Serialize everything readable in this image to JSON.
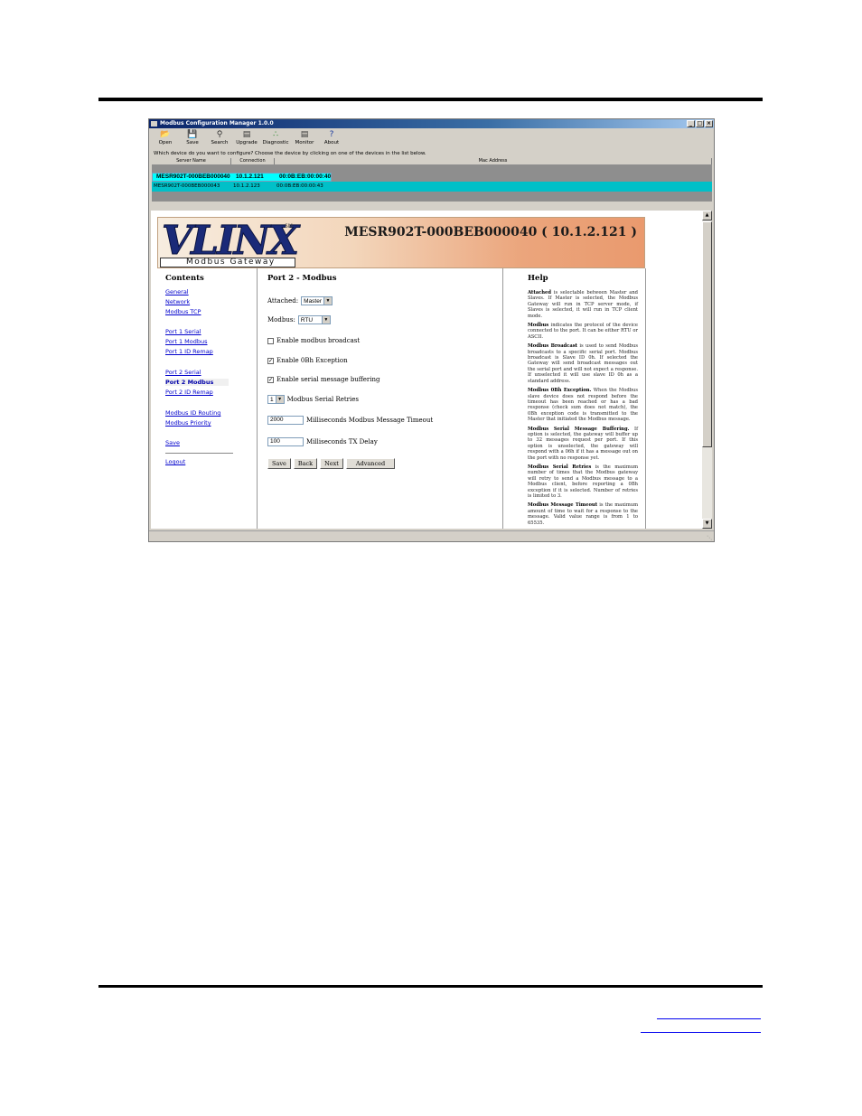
{
  "app": {
    "title": "Modbus Configuration Manager 1.0.0",
    "window_buttons": [
      "_",
      "□",
      "×"
    ],
    "toolbar": [
      {
        "icon": "open-folder-icon",
        "label": "Open"
      },
      {
        "icon": "save-disk-icon",
        "label": "Save"
      },
      {
        "icon": "search-icon",
        "label": "Search"
      },
      {
        "icon": "upgrade-icon",
        "label": "Upgrade"
      },
      {
        "icon": "diagnostic-icon",
        "label": "Diagnostic"
      },
      {
        "icon": "monitor-icon",
        "label": "Monitor"
      },
      {
        "icon": "help-icon",
        "label": "About"
      }
    ],
    "prompt": "Which device do you want to configure? Choose the device by clicking on one of the devices in the list below.",
    "devices": {
      "columns": [
        "Server Name",
        "Connection",
        "Mac Address"
      ],
      "rows": [
        {
          "name": "MESR902T-000BEB000040",
          "connection": "10.1.2.121",
          "mac": "00:0B:EB:00:00:40"
        },
        {
          "name": "MESR902T-000BEB000043",
          "connection": "10.1.2.123",
          "mac": "00:0B:EB:00:00:43"
        }
      ]
    }
  },
  "banner": {
    "logo": "VLINX",
    "logo_tm": "SM",
    "subtitle": "Modbus Gateway",
    "device_title": "MESR902T-000BEB000040 ( 10.1.2.121 )"
  },
  "nav": {
    "heading": "Contents",
    "items": [
      "General",
      "Network",
      "Modbus TCP",
      "Port 1 Serial",
      "Port 1 Modbus",
      "Port 1 ID Remap",
      "Port 2 Serial",
      "Port 2 Modbus",
      "Port 2 ID Remap",
      "Modbus ID Routing",
      "Modbus Priority",
      "Save",
      "Logout"
    ],
    "active": "Port 2 Modbus"
  },
  "form": {
    "heading": "Port 2 - Modbus",
    "attached_label": "Attached:",
    "attached_value": "Master",
    "modbus_label": "Modbus:",
    "modbus_value": "RTU",
    "broadcast_label": "Enable modbus broadcast",
    "broadcast_checked": false,
    "exception_label": "Enable 0Bh Exception",
    "exception_checked": true,
    "buffering_label": "Enable serial message buffering",
    "buffering_checked": true,
    "retries_value": "1",
    "retries_label": "Modbus Serial Retries",
    "timeout_value": "2000",
    "timeout_label": "Milliseconds Modbus Message Timeout",
    "txdelay_value": "100",
    "txdelay_label": "Milliseconds TX Delay",
    "buttons": [
      "Save",
      "Back",
      "Next",
      "Advanced"
    ]
  },
  "help": {
    "heading": "Help",
    "paragraphs": [
      {
        "term": "Attached",
        "text": " is selectable between Master and Slaves. If Master is selected, the Modbus Gateway will run in TCP server mode, if Slaves is selected, it will run in TCP client mode."
      },
      {
        "term": "Modbus",
        "text": " indicates the protocol of the device connected to the port. It can be either RTU or ASCII."
      },
      {
        "term": "Modbus Broadcast",
        "text": " is used to send Modbus broadcasts to a specific serial port. Modbus broadcast is Slave ID 0h. If selected the Gateway will send broadcast messages out the serial port and will not expect a response. If unselected it will use slave ID 0h as a standard address."
      },
      {
        "term": "Modbus 0Bh Exception.",
        "text": " When the Modbus slave device does not respond before the timeout has been reached or has a bad response (check sum does not match), the 0Bh exception code is transmitted to the Master that initiated the Modbus message."
      },
      {
        "term": "Modbus Serial Message Buffering.",
        "text": " If option is selected, the gateway will buffer up to 32 messages request per port. If this option is unselected, the gateway will respond with a 06h if it has a message out on the port with no response yet."
      },
      {
        "term": "Modbus Serial Retries",
        "text": " is the maximum number of times that the Modbus gateway will retry to send a Modbus message to a Modbus client, before reporting a 0Bh exception if it is selected. Number of retries is limited to 3."
      },
      {
        "term": "Modbus Message Timeout",
        "text": " is the maximum amount of time to wait for a response to the message. Valid value range is from 1 to 65535."
      }
    ]
  },
  "colors": {
    "selected_row": "#00ffff",
    "alt_row": "#00c0c8",
    "link": "#0000cc",
    "titlebar": "#0a246a"
  }
}
